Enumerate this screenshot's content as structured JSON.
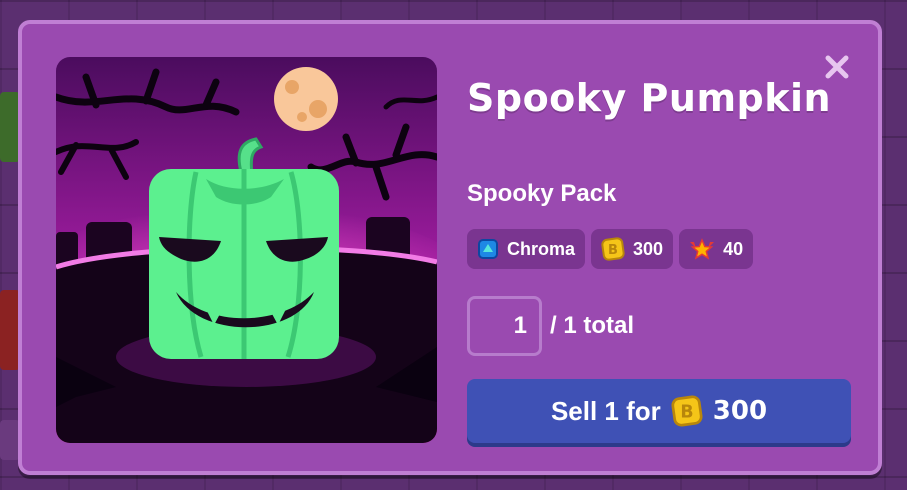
{
  "colors": {
    "modal_bg": "#9a4ab0",
    "badge_bg": "#7a3590",
    "sell_button": "#3f51b5",
    "pumpkin_green": "#5cf08f",
    "token_gold": "#f5c518"
  },
  "item": {
    "title": "Spooky Pumpkin",
    "pack": "Spooky Pack"
  },
  "badges": [
    {
      "icon": "chroma-gem-icon",
      "label": "Chroma"
    },
    {
      "icon": "blook-token-icon",
      "label": "300"
    },
    {
      "icon": "xp-star-icon",
      "label": "40"
    }
  ],
  "quantity": {
    "value": "1",
    "total_label": "/ 1 total"
  },
  "sell": {
    "label": "Sell 1 for",
    "price": "300",
    "icon": "blook-token-icon"
  },
  "close": {
    "icon": "close-icon"
  }
}
